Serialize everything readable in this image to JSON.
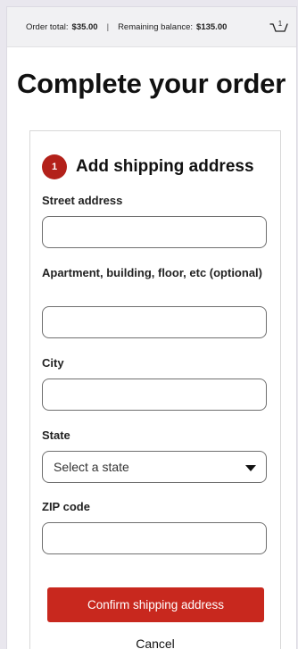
{
  "summary": {
    "order_total_label": "Order total:",
    "order_total_value": "$35.00",
    "separator": "|",
    "remaining_balance_label": "Remaining balance:",
    "remaining_balance_value": "$135.00",
    "cart_count": "1",
    "cart_icon": "cart-icon"
  },
  "page": {
    "title": "Complete your order"
  },
  "shipping": {
    "step_number": "1",
    "step_title": "Add shipping address",
    "fields": {
      "street": {
        "label": "Street address",
        "value": "",
        "placeholder": ""
      },
      "apartment": {
        "label": "Apartment, building, floor, etc (optional)",
        "value": "",
        "placeholder": ""
      },
      "city": {
        "label": "City",
        "value": "",
        "placeholder": ""
      },
      "state": {
        "label": "State",
        "selected": "Select a state"
      },
      "zip": {
        "label": "ZIP code",
        "value": "",
        "placeholder": ""
      }
    },
    "confirm_label": "Confirm shipping address",
    "cancel_label": "Cancel"
  },
  "colors": {
    "accent": "#c8281e",
    "badge": "#b3211a",
    "background": "#e9e7ee"
  }
}
